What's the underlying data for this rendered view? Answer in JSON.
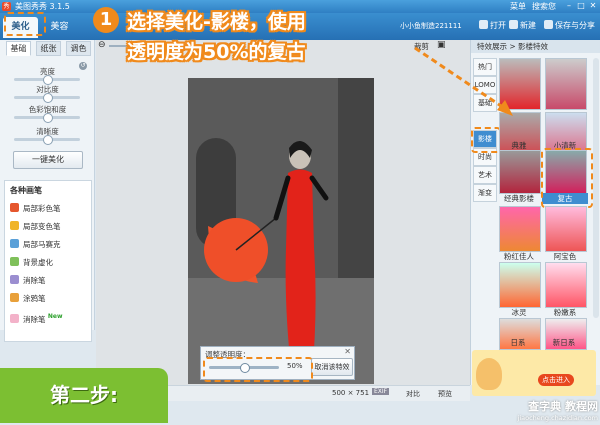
{
  "app": {
    "title": "美图秀秀 3.1.5"
  },
  "titlebar": {
    "menu": [
      "菜单",
      "搜索您"
    ]
  },
  "tabs": [
    {
      "label": "美化"
    },
    {
      "label": "美容"
    }
  ],
  "toolbar": {
    "user": "小小鱼制造221111",
    "open": "打开",
    "new": "新建",
    "save": "保存与分享"
  },
  "left_panel": {
    "subtabs": [
      "基础",
      "纸张",
      "调色"
    ],
    "sliders": [
      {
        "label": "亮度",
        "value_fraction": 0.5
      },
      {
        "label": "对比度",
        "value_fraction": 0.5
      },
      {
        "label": "色彩饱和度",
        "value_fraction": 0.5
      },
      {
        "label": "清晰度",
        "value_fraction": 0.5
      }
    ],
    "one_click": "一键美化",
    "brushes_title": "各种画笔",
    "brushes": [
      "局部彩色笔",
      "局部变色笔",
      "局部马赛克",
      "背景虚化",
      "消除笔",
      "涂鸦笔",
      "消除笔"
    ],
    "new_badge": "New"
  },
  "canvas": {
    "crop": "裁剪"
  },
  "opacity_dialog": {
    "title": "调整透明度：",
    "value": "50%",
    "value_fraction": 0.5,
    "cancel": "取消该特效"
  },
  "status": {
    "size": "500 × 751",
    "exif": "EXIF",
    "compare": "对比",
    "preview": "预览"
  },
  "right_panel": {
    "crumb": "特效展示 > 影楼特效",
    "categories": [
      "热门",
      "LOMO",
      "基础",
      "影楼",
      "时尚",
      "艺术",
      "渐变"
    ],
    "thumbs": [
      {
        "label": ""
      },
      {
        "label": ""
      },
      {
        "label": "典雅"
      },
      {
        "label": "小清新"
      },
      {
        "label": "经典影楼"
      },
      {
        "label": "复古"
      },
      {
        "label": "粉红佳人"
      },
      {
        "label": "阿宝色"
      },
      {
        "label": "冰灵"
      },
      {
        "label": "粉嫩系"
      },
      {
        "label": "日系"
      },
      {
        "label": "新日系"
      }
    ],
    "promo": "点击进入"
  },
  "overlay": {
    "step_number": "1",
    "instruction_line1": "选择美化-影楼，使用",
    "instruction_line2": "透明度为50%的复古",
    "bottom_badge": "第二步:",
    "watermark_line1": "查字典 教程网",
    "watermark_line2": "jiaocheng.chazidian.com"
  },
  "colors": {
    "accent": "#f08a1c",
    "brand_blue": "#2f7fc3",
    "badge_green": "#7cbf32"
  }
}
